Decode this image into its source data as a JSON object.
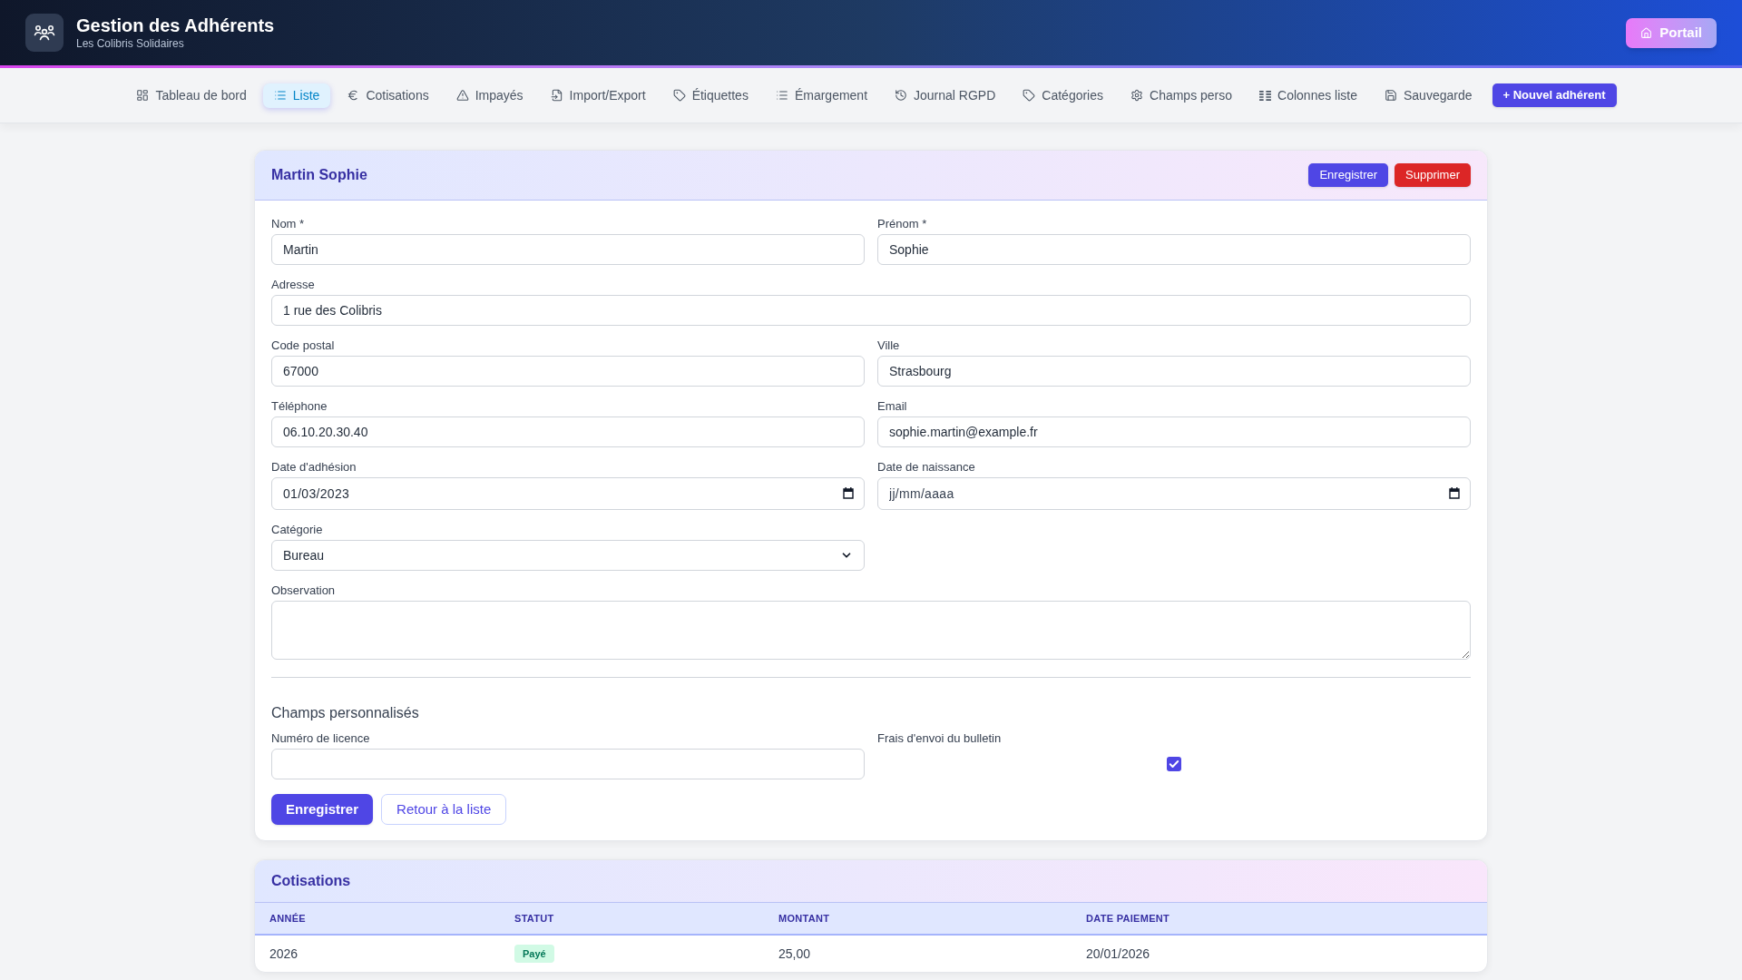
{
  "header": {
    "title": "Gestion des Adhérents",
    "subtitle": "Les Colibris Solidaires",
    "portal_button": "Portail"
  },
  "nav": {
    "tabs": [
      {
        "label": "Tableau de bord",
        "selected": false
      },
      {
        "label": "Liste",
        "selected": true
      },
      {
        "label": "Cotisations",
        "selected": false
      },
      {
        "label": "Impayés",
        "selected": false
      },
      {
        "label": "Import/Export",
        "selected": false
      },
      {
        "label": "Étiquettes",
        "selected": false
      },
      {
        "label": "Émargement",
        "selected": false
      },
      {
        "label": "Journal RGPD",
        "selected": false
      },
      {
        "label": "Catégories",
        "selected": false
      },
      {
        "label": "Champs perso",
        "selected": false
      },
      {
        "label": "Colonnes liste",
        "selected": false
      },
      {
        "label": "Sauvegarde",
        "selected": false
      }
    ],
    "new_button": "+ Nouvel adhérent"
  },
  "member_form": {
    "title": "Martin Sophie",
    "header_buttons": [
      {
        "label": "Enregistrer",
        "kind": "primary"
      },
      {
        "label": "Supprimer",
        "kind": "danger"
      }
    ],
    "rows": [
      [
        {
          "label": "Nom *",
          "kind": "text",
          "value": "Martin"
        },
        {
          "label": "Prénom *",
          "kind": "text",
          "value": "Sophie"
        }
      ],
      [
        {
          "label": "Adresse",
          "kind": "text",
          "value": "1 rue des Colibris"
        }
      ],
      [
        {
          "label": "Code postal",
          "kind": "text",
          "value": "67000"
        },
        {
          "label": "Ville",
          "kind": "text",
          "value": "Strasbourg"
        }
      ],
      [
        {
          "label": "Téléphone",
          "kind": "text",
          "value": "06.10.20.30.40"
        },
        {
          "label": "Email",
          "kind": "text",
          "value": "sophie.martin@example.fr"
        }
      ],
      [
        {
          "label": "Date d'adhésion",
          "kind": "date",
          "value": "01/03/2023"
        },
        {
          "label": "Date de naissance",
          "kind": "date",
          "placeholder": "jj/mm/aaaa"
        }
      ],
      [
        {
          "label": "Catégorie",
          "kind": "select",
          "value": "Bureau"
        }
      ],
      [
        {
          "label": "Observation",
          "kind": "textarea"
        }
      ]
    ],
    "custom_fields": {
      "title": "Champs personnalisés",
      "fields": [
        {
          "label": "Numéro de licence",
          "kind": "text"
        },
        {
          "label": "Frais d'envoi du bulletin",
          "kind": "checkbox",
          "checked": true
        }
      ]
    },
    "footer_buttons": [
      {
        "label": "Enregistrer",
        "kind": "primary"
      },
      {
        "label": "Retour à la liste",
        "kind": "outline"
      }
    ]
  },
  "contributions": {
    "title": "Cotisations",
    "columns": [
      "ANNÉE",
      "STATUT",
      "MONTANT",
      "DATE PAIEMENT"
    ],
    "rows": [
      {
        "year": "2026",
        "status": {
          "label": "Payé",
          "kind": "paid"
        },
        "amount": "25,00",
        "payment_date": "20/01/2026"
      }
    ]
  }
}
